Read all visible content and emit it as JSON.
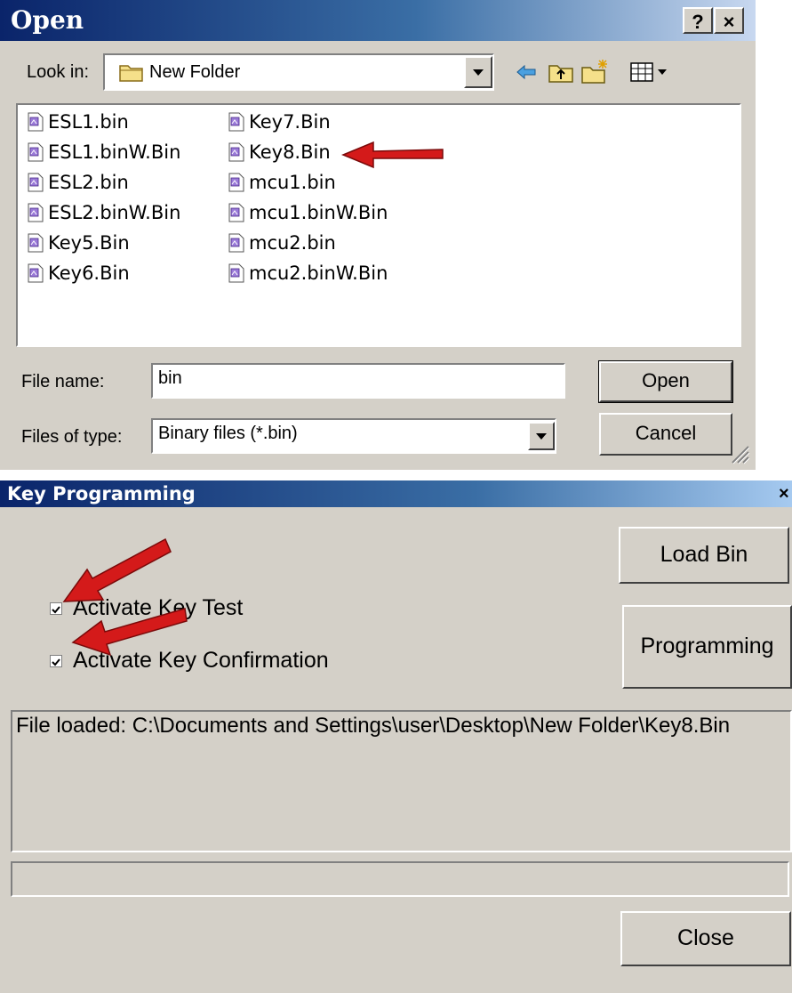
{
  "open_dialog": {
    "title": "Open",
    "help_button": "?",
    "close_button": "×",
    "look_in_label": "Look in:",
    "look_in_value": "New Folder",
    "files": [
      "ESL1.bin",
      "ESL1.binW.Bin",
      "ESL2.bin",
      "ESL2.binW.Bin",
      "Key5.Bin",
      "Key6.Bin",
      "Key7.Bin",
      "Key8.Bin",
      "mcu1.bin",
      "mcu1.binW.Bin",
      "mcu2.bin",
      "mcu2.binW.Bin"
    ],
    "file_name_label": "File name:",
    "file_name_value": "bin",
    "files_of_type_label": "Files of type:",
    "files_of_type_value": "Binary files (*.bin)",
    "open_button": "Open",
    "cancel_button": "Cancel"
  },
  "key_programming": {
    "title": "Key Programming",
    "close_glyph": "×",
    "load_bin_button": "Load Bin",
    "programming_button": "Programming",
    "activate_key_test_label": "Activate Key Test",
    "activate_key_test_checked": true,
    "activate_key_confirmation_label": "Activate Key Confirmation",
    "activate_key_confirmation_checked": true,
    "log_text": "File loaded: C:\\Documents and Settings\\user\\Desktop\\New Folder\\Key8.Bin",
    "close_button": "Close"
  },
  "colors": {
    "dialog_bg": "#d4d0c8",
    "titlebar": "#0a246a",
    "annotation_arrow": "#d41a1a"
  }
}
